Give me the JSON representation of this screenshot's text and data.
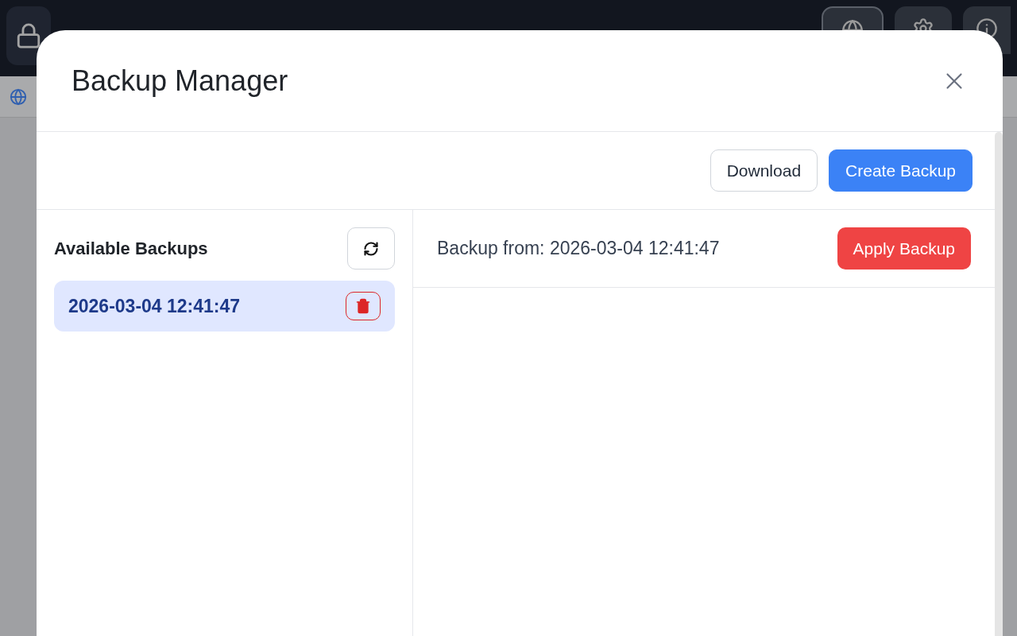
{
  "dialog": {
    "title": "Backup Manager"
  },
  "toolbar": {
    "buttons": [
      {
        "label": "Download",
        "kind": "secondary"
      },
      {
        "label": "Create Backup",
        "kind": "primary"
      }
    ]
  },
  "backups_panel": {
    "title": "Available Backups",
    "items": [
      {
        "label": "2026-03-04 12:41:47",
        "selected": true
      }
    ]
  },
  "details": {
    "title": "Backup from: 2026-03-04 12:41:47",
    "apply_button": "Apply Backup"
  }
}
